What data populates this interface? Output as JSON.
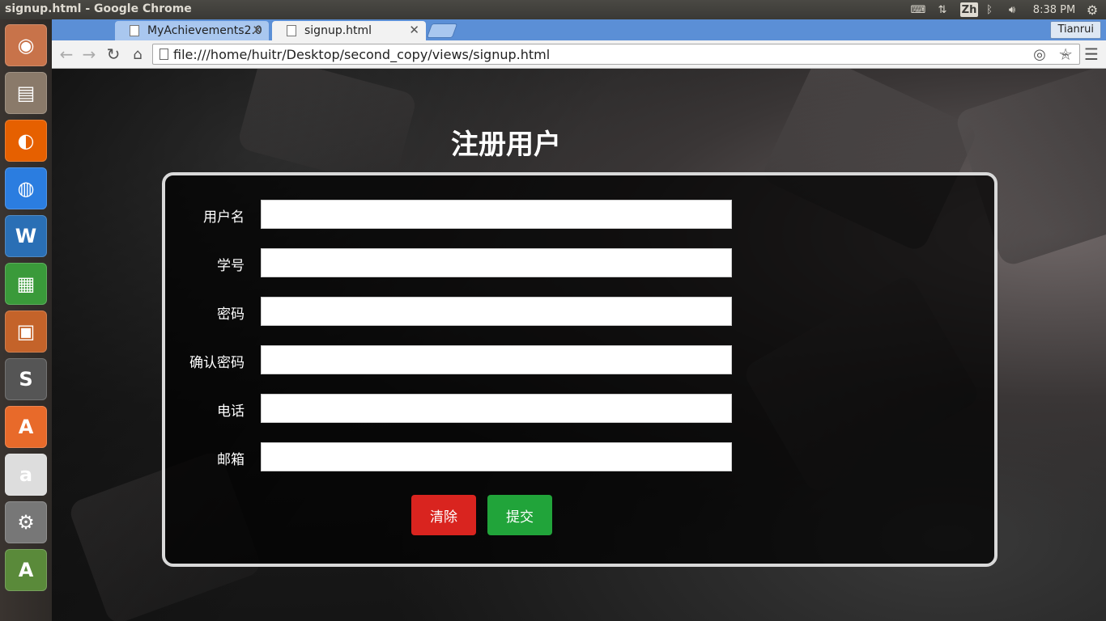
{
  "os": {
    "window_title": "signup.html - Google Chrome",
    "tray": {
      "ime": "Zh",
      "time": "8:38 PM"
    },
    "launcher": [
      {
        "icon": "ubuntu-dash-icon",
        "color": "#c8734a"
      },
      {
        "icon": "files-icon",
        "color": "#8a7a6a"
      },
      {
        "icon": "firefox-icon",
        "color": "#e66000"
      },
      {
        "icon": "chrome-icon",
        "color": "#2b7de0"
      },
      {
        "icon": "libreoffice-writer-icon",
        "color": "#2a6fb5"
      },
      {
        "icon": "libreoffice-calc-icon",
        "color": "#3a9a3a"
      },
      {
        "icon": "libreoffice-impress-icon",
        "color": "#c4632a"
      },
      {
        "icon": "sublime-text-icon",
        "color": "#555555"
      },
      {
        "icon": "software-center-icon",
        "color": "#e86a2a"
      },
      {
        "icon": "amazon-icon",
        "color": "#dddddd"
      },
      {
        "icon": "system-settings-icon",
        "color": "#777777"
      },
      {
        "icon": "software-updater-icon",
        "color": "#5a8a3a"
      }
    ],
    "launcher_glyphs": [
      "◉",
      "▤",
      "◐",
      "◍",
      "W",
      "▦",
      "▣",
      "S",
      "A",
      "a",
      "⚙",
      "A"
    ]
  },
  "browser": {
    "tabs": [
      {
        "label": "MyAchievements2.0",
        "active": false
      },
      {
        "label": "signup.html",
        "active": true
      }
    ],
    "profile": "Tianrui",
    "url": "file:///home/huitr/Desktop/second_copy/views/signup.html"
  },
  "page": {
    "title": "注册用户",
    "fields": [
      {
        "label": "用户名",
        "value": ""
      },
      {
        "label": "学号",
        "value": ""
      },
      {
        "label": "密码",
        "value": ""
      },
      {
        "label": "确认密码",
        "value": ""
      },
      {
        "label": "电话",
        "value": ""
      },
      {
        "label": "邮箱",
        "value": ""
      }
    ],
    "buttons": {
      "clear": "清除",
      "submit": "提交"
    },
    "colors": {
      "clear": "#d9241f",
      "submit": "#21a43a"
    }
  }
}
